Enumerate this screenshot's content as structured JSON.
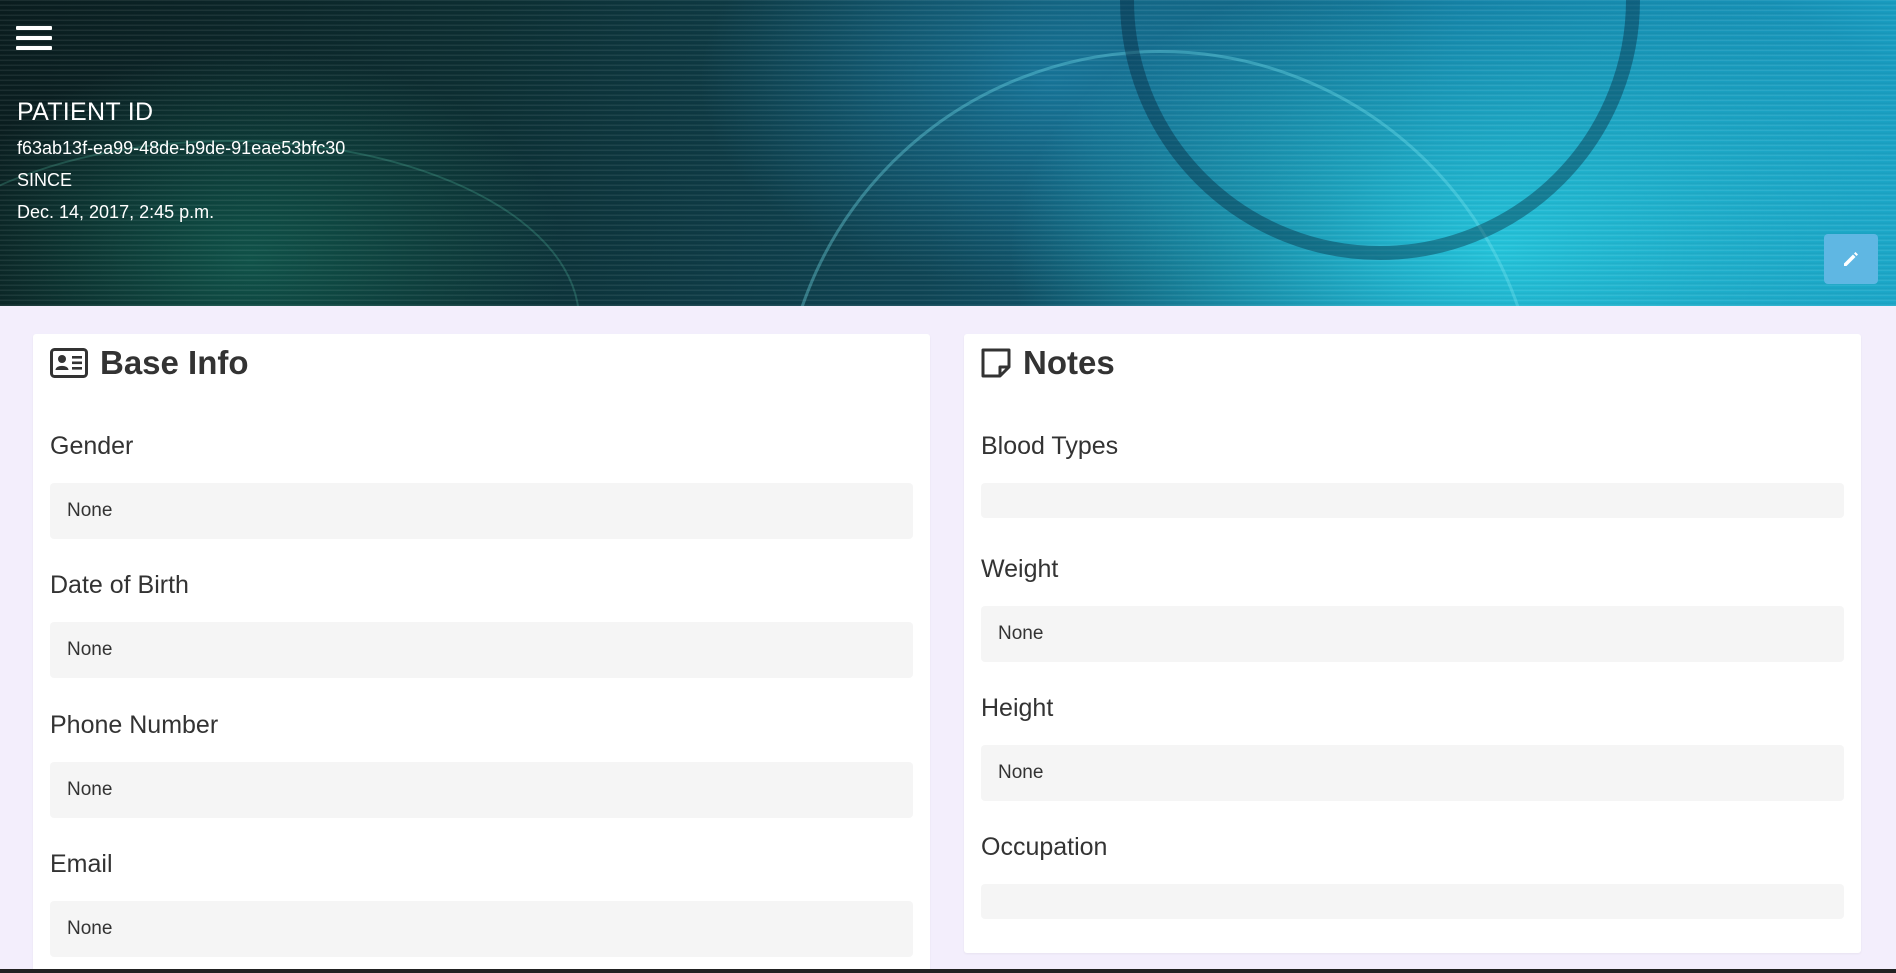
{
  "header": {
    "title": "PATIENT ID",
    "patient_id": "f63ab13f-ea99-48de-b9de-91eae53bfc30",
    "since_label": "SINCE",
    "since_value": "Dec. 14, 2017, 2:45 p.m."
  },
  "icons": {
    "menu": "hamburger-menu-icon",
    "edit": "pencil-icon",
    "base_info": "id-card-icon",
    "notes": "sticky-note-icon"
  },
  "colors": {
    "page_bg": "#f3eefc",
    "edit_button": "#5fb7e3",
    "field_bg": "#f5f5f5"
  },
  "base_info": {
    "title": "Base Info",
    "fields": [
      {
        "label": "Gender",
        "value": "None"
      },
      {
        "label": "Date of Birth",
        "value": "None"
      },
      {
        "label": "Phone Number",
        "value": "None"
      },
      {
        "label": "Email",
        "value": "None"
      }
    ]
  },
  "notes": {
    "title": "Notes",
    "fields": [
      {
        "label": "Blood Types",
        "value": ""
      },
      {
        "label": "Weight",
        "value": "None"
      },
      {
        "label": "Height",
        "value": "None"
      },
      {
        "label": "Occupation",
        "value": ""
      }
    ]
  }
}
